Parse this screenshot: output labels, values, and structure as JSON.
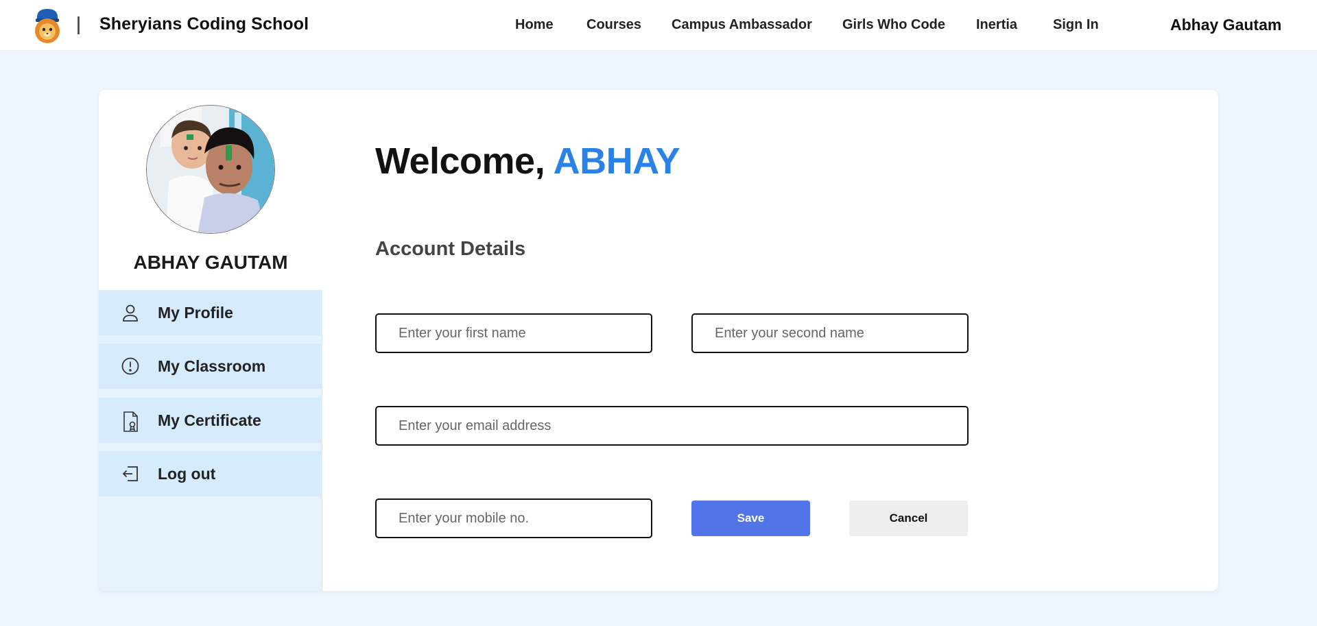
{
  "header": {
    "brand_name": "Sheryians Coding School",
    "logo_icon": "lion-mascot-icon",
    "nav": [
      {
        "label": "Home"
      },
      {
        "label": "Courses"
      },
      {
        "label": "Campus Ambassador"
      },
      {
        "label": "Girls Who Code"
      },
      {
        "label": "Inertia"
      },
      {
        "label": "Sign In"
      }
    ],
    "user_name": "Abhay Gautam"
  },
  "sidebar": {
    "profile_name": "ABHAY GAUTAM",
    "avatar_icon": "profile-photo",
    "items": [
      {
        "label": "My Profile",
        "icon": "user-icon"
      },
      {
        "label": "My Classroom",
        "icon": "alert-circle-icon"
      },
      {
        "label": "My Certificate",
        "icon": "certificate-icon"
      },
      {
        "label": "Log out",
        "icon": "logout-icon"
      }
    ]
  },
  "main": {
    "welcome_prefix": "Welcome,",
    "welcome_name": "ABHAY",
    "section_title": "Account Details",
    "fields": {
      "first_name": {
        "value": "",
        "placeholder": "Enter your first name"
      },
      "second_name": {
        "value": "",
        "placeholder": "Enter your second name"
      },
      "email": {
        "value": "",
        "placeholder": "Enter your email address"
      },
      "mobile": {
        "value": "",
        "placeholder": "Enter your mobile no."
      }
    },
    "save_label": "Save",
    "cancel_label": "Cancel"
  },
  "colors": {
    "accent": "#2a82e8",
    "save_button": "#5175e8",
    "page_bg": "#eef5fe",
    "sidebar_item_bg": "#d6ebfd"
  }
}
